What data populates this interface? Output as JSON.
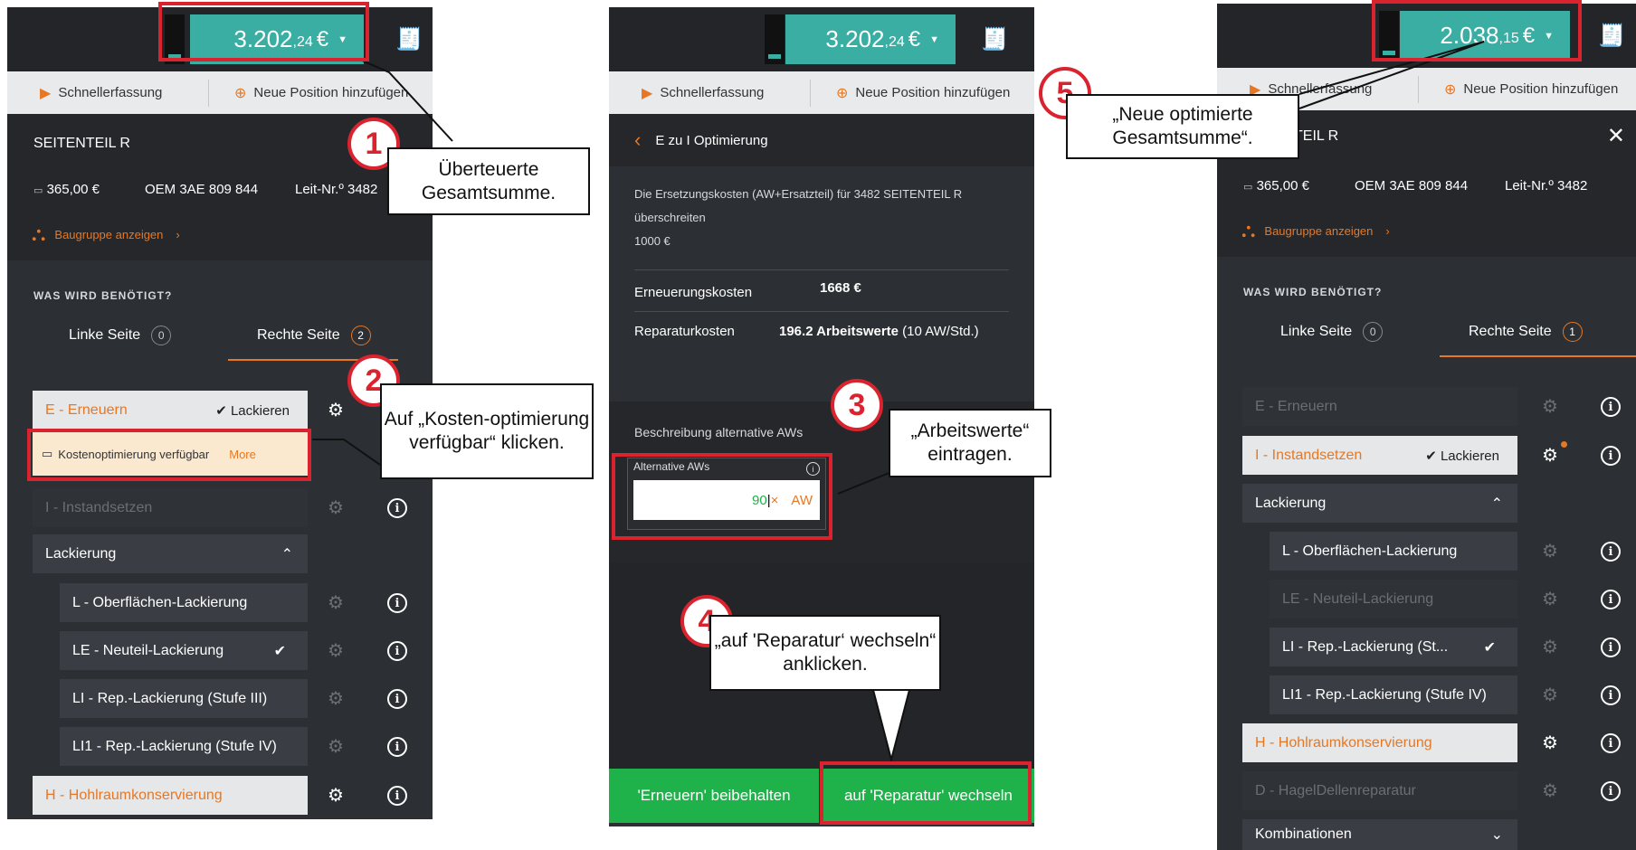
{
  "panel1": {
    "total": {
      "main": "3.202",
      "cents": ",24",
      "currency": "€"
    },
    "toolbar": {
      "quick": "Schnellerfassung",
      "add": "Neue Position hinzufügen"
    },
    "part_title": "SEITENTEIL R",
    "price": "365,00 €",
    "oem": "OEM 3AE 809 844",
    "leit": "Leit-Nr.º 3482",
    "assembly": "Baugruppe anzeigen",
    "needed": "WAS WIRD BENÖTIGT?",
    "tab_left": "Linke Seite",
    "tab_left_count": "0",
    "tab_right": "Rechte Seite",
    "tab_right_count": "2",
    "erneuern": "E - Erneuern",
    "lackieren": "Lackieren",
    "kostenopt": "Kostenoptimierung verfügbar",
    "more": "More",
    "instandsetzen": "I - Instandsetzen",
    "lackierung": "Lackierung",
    "l_ober": "L - Oberflächen-Lackierung",
    "le_neu": "LE - Neuteil-Lackierung",
    "li_rep": "LI - Rep.-Lackierung (Stufe III)",
    "li1_rep": "LI1 - Rep.-Lackierung (Stufe IV)",
    "hohl": "H - Hohlraumkonservierung"
  },
  "panel2": {
    "total": {
      "main": "3.202",
      "cents": ",24",
      "currency": "€"
    },
    "toolbar": {
      "quick": "Schnellerfassung",
      "add": "Neue Position hinzufügen"
    },
    "back_title": "E zu I Optimierung",
    "desc1": "Die Ersetzungskosten (AW+Ersatzteil) für 3482 SEITENTEIL R",
    "desc2": "überschreiten",
    "desc3": "1000 €",
    "cost_renew_label": "Erneuerungskosten",
    "cost_renew_value": "1668 €",
    "cost_repair_label": "Reparaturkosten",
    "cost_repair_value_bold": "196.2 Arbeitswerte",
    "cost_repair_value_rest": " (10 AW/Std.)",
    "alt_desc": "Beschreibung alternative AWs",
    "alt_label": "Alternative AWs",
    "alt_value": "90",
    "alt_unit": "AW",
    "btn_keep": "'Erneuern' beibehalten",
    "btn_switch": "auf 'Reparatur' wechseln"
  },
  "panel3": {
    "total": {
      "main": "2.038",
      "cents": ",15",
      "currency": "€"
    },
    "toolbar": {
      "quick": "Schnellerfassung",
      "add": "Neue Position hinzufügen"
    },
    "part_title": "TEIL R",
    "price": "365,00 €",
    "oem": "OEM 3AE 809 844",
    "leit": "Leit-Nr.º 3482",
    "assembly": "Baugruppe anzeigen",
    "needed": "WAS WIRD BENÖTIGT?",
    "tab_left": "Linke Seite",
    "tab_left_count": "0",
    "tab_right": "Rechte Seite",
    "tab_right_count": "1",
    "erneuern": "E - Erneuern",
    "instandsetzen": "I - Instandsetzen",
    "lackieren": "Lackieren",
    "lackierung": "Lackierung",
    "l_ober": "L - Oberflächen-Lackierung",
    "le_neu": "LE - Neuteil-Lackierung",
    "li_rep": "LI - Rep.-Lackierung (St...",
    "li1_rep": "LI1 - Rep.-Lackierung (Stufe IV)",
    "hohl": "H - Hohlraumkonservierung",
    "hagel": "D - HagelDellenreparatur",
    "kombi": "Kombinationen"
  },
  "callouts": {
    "c1": "Überteuerte Gesamtsumme.",
    "c2": "Auf „Kosten-optimierung verfügbar“ klicken.",
    "c3": "„Arbeitswerte“ eintragen.",
    "c4": "„auf 'Reparatur‘ wechseln“ anklicken.",
    "c5": "„Neue optimierte Gesamtsumme“."
  },
  "steps": [
    "1",
    "2",
    "3",
    "4",
    "5"
  ],
  "colors": {
    "teal": "#3aaea3",
    "orange": "#e87722",
    "red": "#d9232e",
    "green": "#1fb24a",
    "panel": "#2c2f33"
  }
}
